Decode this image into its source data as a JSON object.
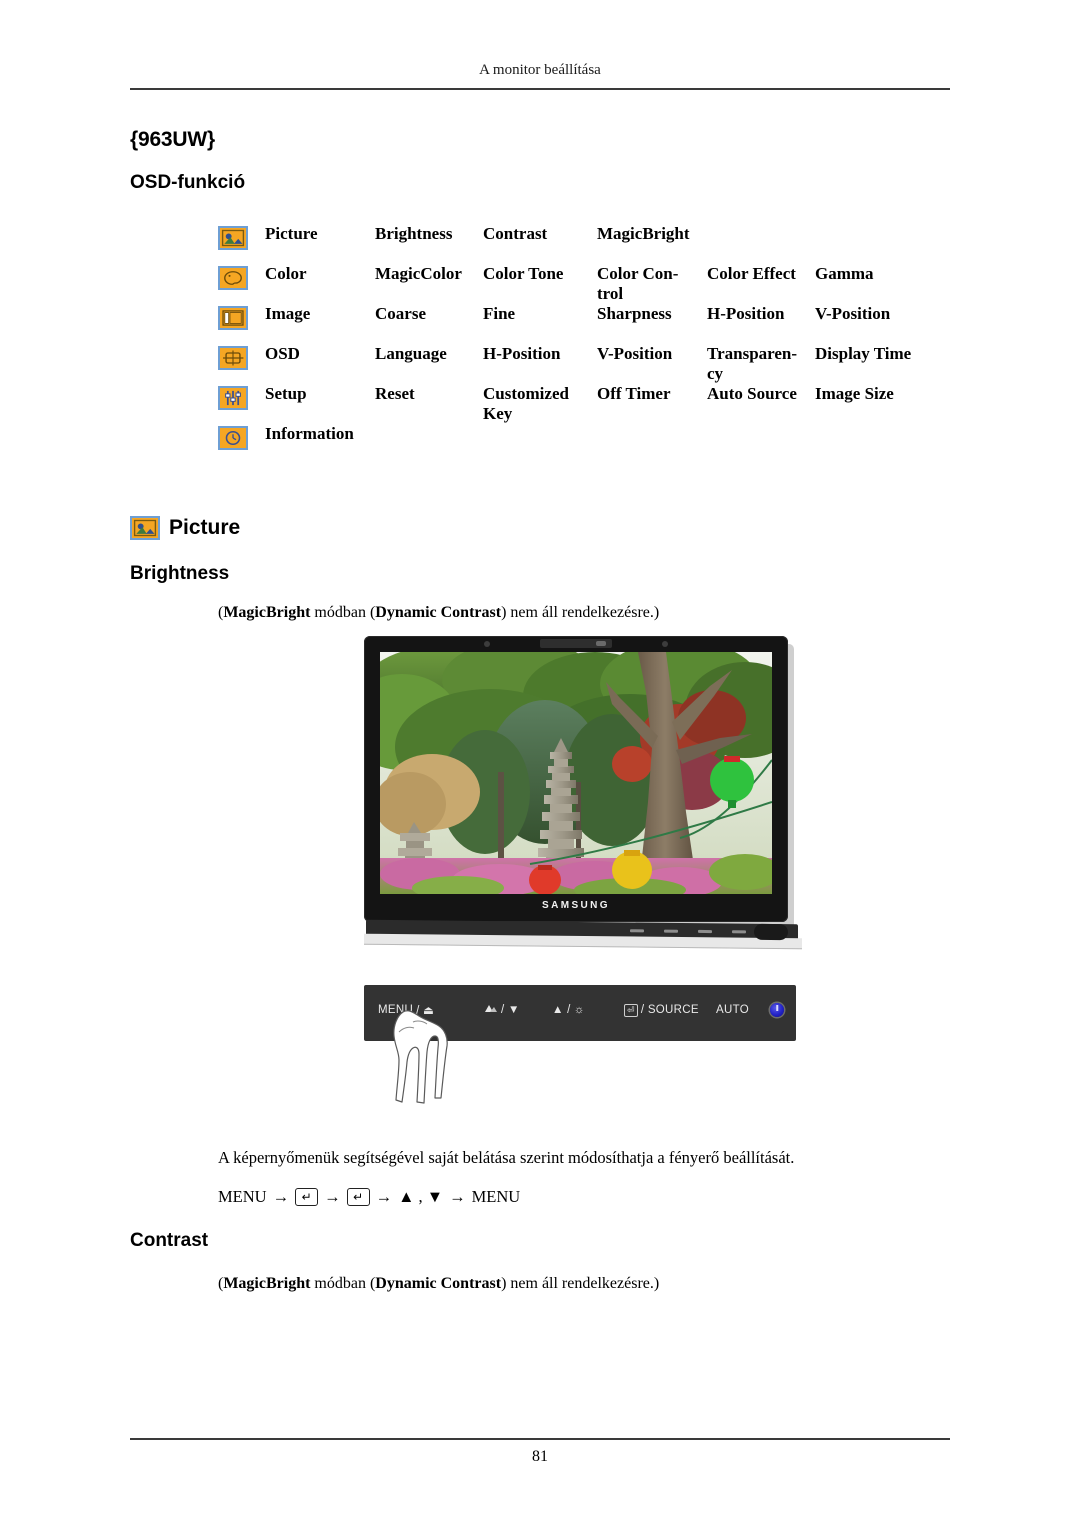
{
  "header": {
    "running_title": "A monitor beállítása"
  },
  "titles": {
    "model": "{963UW}",
    "section": "OSD-funkció",
    "picture": "Picture",
    "brightness": "Brightness",
    "contrast": "Contrast"
  },
  "osd_table": {
    "rows": [
      {
        "icon": "picture-icon",
        "label": "Picture",
        "cells": [
          "Brightness",
          "Contrast",
          "MagicBright",
          "",
          ""
        ]
      },
      {
        "icon": "color-icon",
        "label": "Color",
        "cells": [
          "MagicColor",
          "Color Tone",
          "Color Con-trol",
          "Color Effect",
          "Gamma"
        ]
      },
      {
        "icon": "image-icon",
        "label": "Image",
        "cells": [
          "Coarse",
          "Fine",
          "Sharpness",
          "H-Position",
          "V-Position"
        ]
      },
      {
        "icon": "osd-icon",
        "label": "OSD",
        "cells": [
          "Language",
          "H-Position",
          "V-Position",
          "Transparen-cy",
          "Display Time"
        ]
      },
      {
        "icon": "setup-icon",
        "label": "Setup",
        "cells": [
          "Reset",
          "Customized Key",
          "Off Timer",
          "Auto Source",
          "Image Size"
        ]
      },
      {
        "icon": "information-icon",
        "label": "Information",
        "cells": [
          "",
          "",
          "",
          "",
          ""
        ]
      }
    ]
  },
  "notes": {
    "magicbright_prefix": "(",
    "magicbright_bold1": "MagicBright",
    "magicbright_mid": " módban (",
    "magicbright_bold2": "Dynamic Contrast",
    "magicbright_suffix": ") nem áll rendelkezésre.)",
    "full": "(MagicBright módban (Dynamic Contrast) nem áll rendelkezésre.)"
  },
  "monitor": {
    "brand": "SAMSUNG",
    "screen_description": "Kerti fénykép: kőpagoda, fák, virágok és színes lampionok"
  },
  "control_panel": {
    "buttons": [
      {
        "label": "MENU",
        "glyph": "exit-icon"
      },
      {
        "label": "",
        "glyph": "magicbright-icon",
        "suffix": "/ ▼"
      },
      {
        "label": "",
        "glyph": "up-arrow-icon",
        "suffix": "/ brightness"
      },
      {
        "label": "SOURCE",
        "glyph": "enter-icon"
      },
      {
        "label": "AUTO",
        "glyph": ""
      },
      {
        "label": "",
        "glyph": "power-icon"
      }
    ],
    "menu_label": "MENU",
    "menu_glyph": "/ ⏏",
    "magicbright_label": "/ ▼",
    "up_label": "▲ /",
    "brightness_glyph": "☼",
    "source_label": "/ SOURCE",
    "auto_label": "AUTO"
  },
  "body": {
    "description": "A képernyőmenük segítségével saját belátása szerint módosíthatja a fényerő beállítását.",
    "menu_sequence": {
      "start": "MENU",
      "arrow": "→",
      "enter_key": "↵",
      "updown": "▲ , ▼",
      "end": "MENU"
    }
  },
  "footer": {
    "page_number": "81"
  }
}
